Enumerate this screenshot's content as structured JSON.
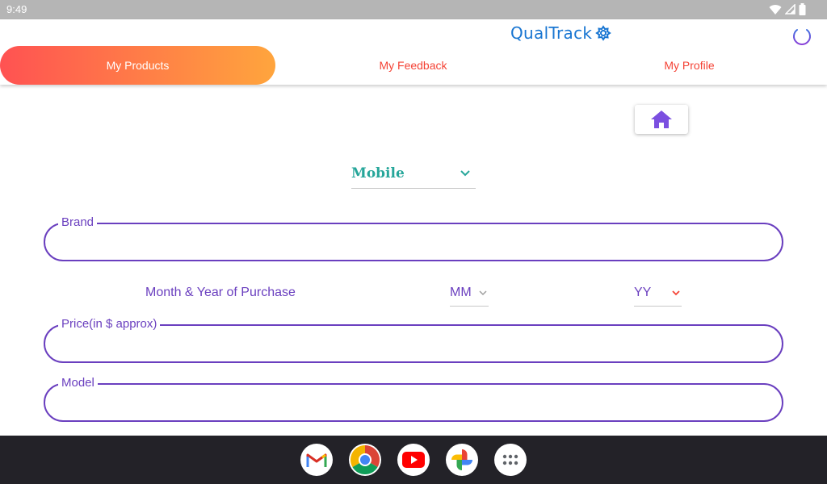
{
  "status_bar": {
    "time": "9:49"
  },
  "header": {
    "app_name": "QualTrack"
  },
  "tabs": [
    {
      "label": "My Products",
      "active": true
    },
    {
      "label": "My Feedback",
      "active": false
    },
    {
      "label": "My Profile",
      "active": false
    }
  ],
  "form": {
    "category": "Mobile",
    "brand_label": "Brand",
    "brand_value": "",
    "purchase_label": "Month & Year of Purchase",
    "month_value": "MM",
    "year_value": "YY",
    "price_label": "Price(in $ approx)",
    "price_value": "",
    "model_label": "Model",
    "model_value": ""
  },
  "colors": {
    "accent_purple": "#6a3fbf",
    "brand_blue": "#1976d2",
    "tab_red": "#f44336",
    "teal": "#26a69a"
  },
  "dock": [
    "gmail-icon",
    "chrome-icon",
    "youtube-icon",
    "photos-icon",
    "app-drawer-icon"
  ]
}
